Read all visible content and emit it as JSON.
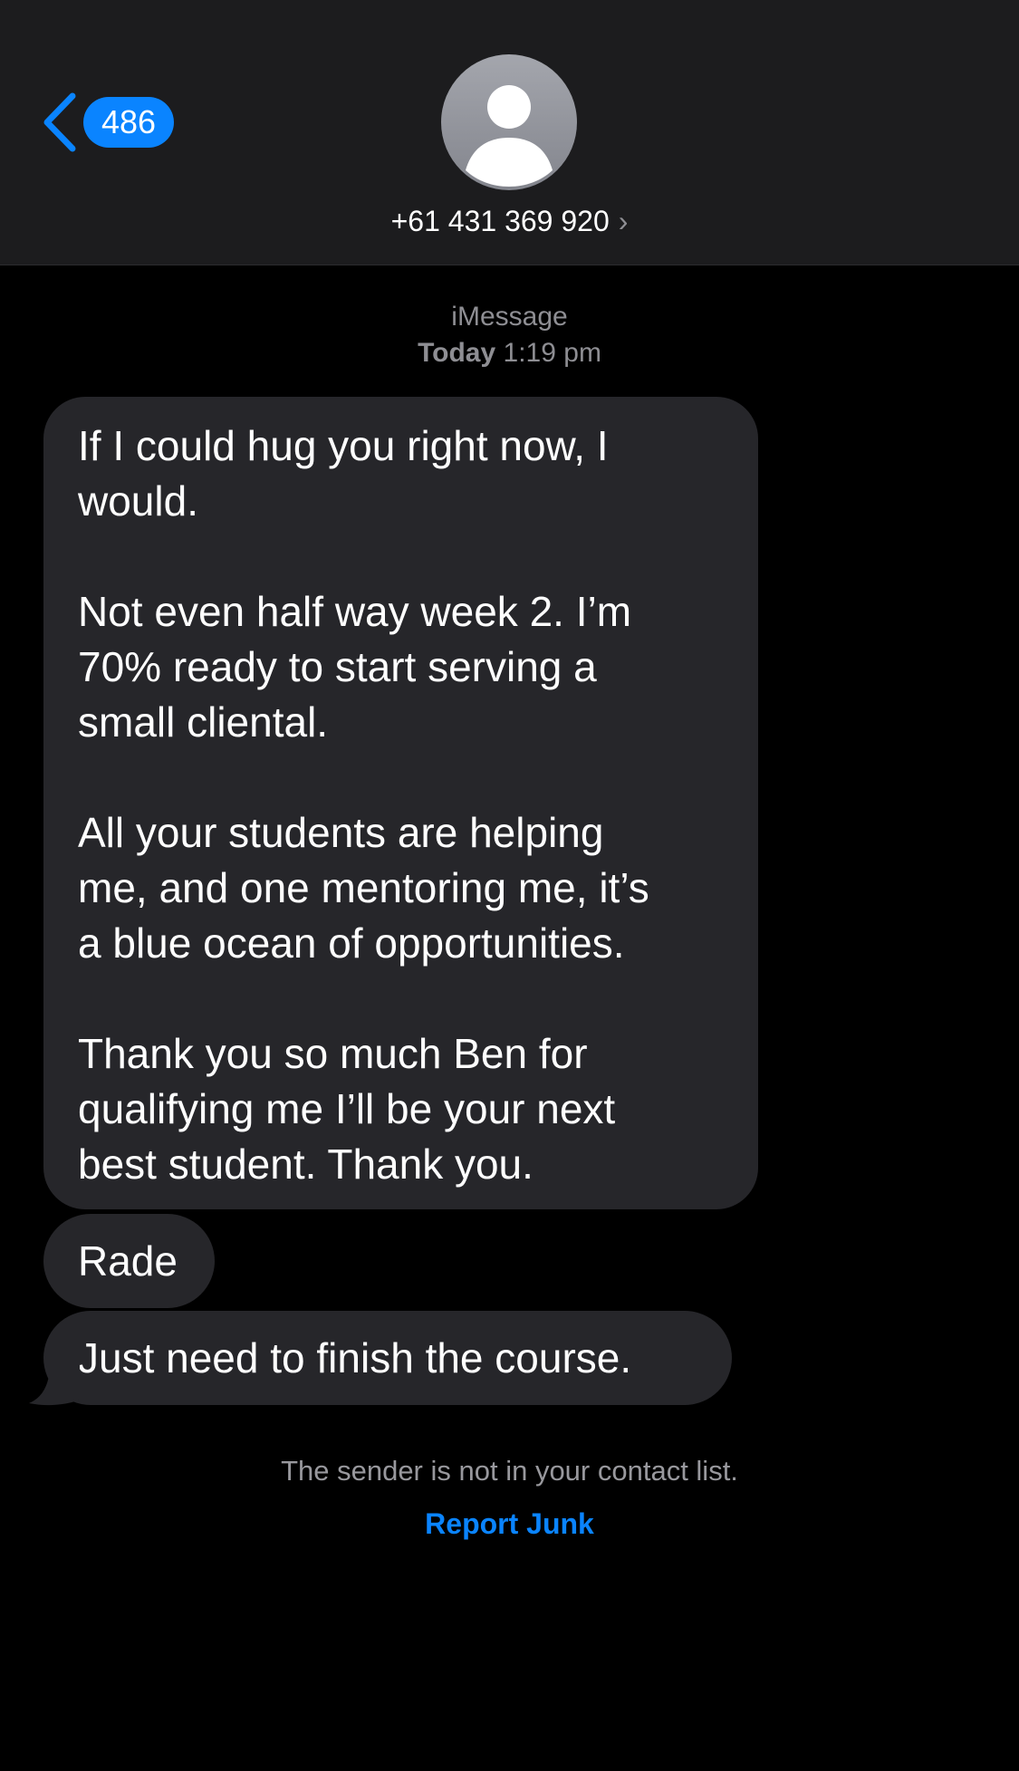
{
  "colors": {
    "background": "#000000",
    "header": "#1c1c1e",
    "bubble": "#26262a",
    "accent": "#0a84ff",
    "secondary_text": "#8e8e93",
    "status_pill": "#34c759"
  },
  "header": {
    "back_icon": "chevron-left-icon",
    "back_count": "486",
    "avatar_icon": "person-silhouette-icon",
    "contact": "+61 431 369 920",
    "contact_chevron": "›"
  },
  "conversation": {
    "service": "iMessage",
    "day": "Today",
    "time": "1:19 pm",
    "messages": [
      {
        "direction": "incoming",
        "text": "If I could hug you right now, I\nwould.\n\nNot even half way week 2. I’m\n70% ready to start serving a\nsmall cliental.\n\nAll your students are helping\nme, and one mentoring me, it’s\na blue ocean of opportunities.\n\nThank you so much Ben for\nqualifying me I’ll be your next\nbest student. Thank you."
      },
      {
        "direction": "incoming",
        "text": "Rade"
      },
      {
        "direction": "incoming",
        "text": "Just need to finish the course."
      }
    ]
  },
  "footer": {
    "notice": "The sender is not in your contact list.",
    "report_label": "Report Junk"
  }
}
